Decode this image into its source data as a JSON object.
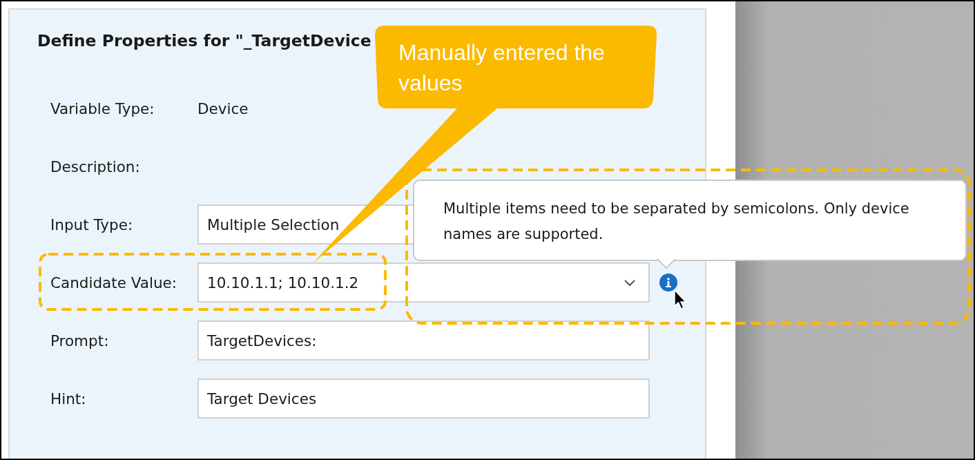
{
  "dialog": {
    "title": "Define Properties for \"_TargetDevice",
    "fields": [
      {
        "label": "Variable Type:",
        "kind": "text",
        "value": "Device"
      },
      {
        "label": "Description:",
        "kind": "text"
      },
      {
        "label": "Input Type:",
        "kind": "input",
        "value": "Multiple Selection"
      },
      {
        "label": "Candidate Value:",
        "kind": "select",
        "value": "10.10.1.1; 10.10.1.2",
        "info": true
      },
      {
        "label": "Prompt:",
        "kind": "input",
        "value": "TargetDevices:"
      },
      {
        "label": "Hint:",
        "kind": "input",
        "value": "Target Devices"
      }
    ]
  },
  "tooltip": {
    "text": "Multiple items need to be separated by semicolons. Only device names are supported."
  },
  "callout": {
    "text": "Manually entered the values"
  }
}
